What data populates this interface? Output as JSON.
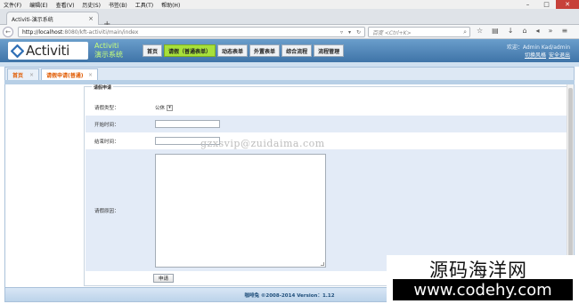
{
  "browser": {
    "menu": [
      "文件(F)",
      "编辑(E)",
      "查看(V)",
      "历史(S)",
      "书签(B)",
      "工具(T)",
      "帮助(H)"
    ],
    "tab_title": "Activiti-演示系统",
    "url_host": "http://localhost",
    "url_path": ":8080/kft-activiti/main/index",
    "search_placeholder": "百度 <Ctrl+K>"
  },
  "app": {
    "logo_text": "Activiti",
    "name_line1": "Activiti",
    "name_line2": "演示系统",
    "nav": [
      "首页",
      "请假（普通表单）",
      "动态表单",
      "外置表单",
      "综合流程",
      "流程管理"
    ],
    "active_nav": "请假（普通表单）",
    "user_line": "欢迎：Admin Kad/admin",
    "switch_style": "切换风格",
    "logout": "安全退出"
  },
  "page_tabs": [
    {
      "label": "首页"
    },
    {
      "label": "请假申请(普通)"
    }
  ],
  "form": {
    "legend": "请假申请",
    "leave_type_label": "请假类型：",
    "leave_type_value": "公休",
    "start_label": "开始时间：",
    "end_label": "结束时间：",
    "reason_label": "请假原因：",
    "submit_label": "申请"
  },
  "watermark": "gzxsvip@zuidaima.com",
  "footer": "咖啡兔 ©2008-2014 Version：1.12",
  "badge": {
    "cn": "源码海洋网",
    "en": "www.codehy.com"
  }
}
